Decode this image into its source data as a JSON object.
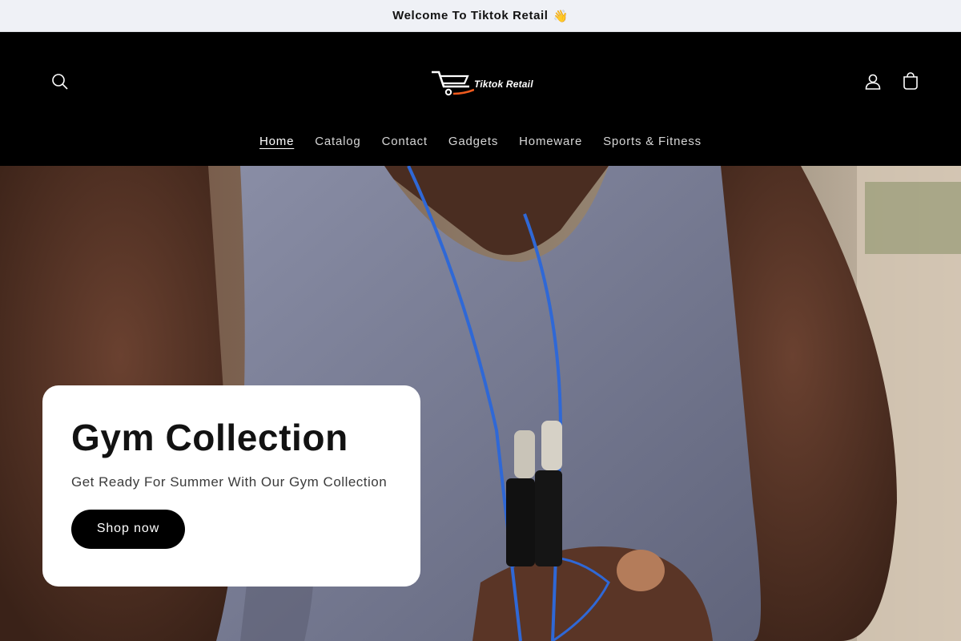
{
  "announcement": {
    "text": "Welcome To Tiktok Retail",
    "emoji": "👋"
  },
  "header": {
    "logo_text": "Tiktok Retail",
    "icons": [
      "search-icon",
      "account-icon",
      "cart-icon"
    ]
  },
  "nav": {
    "items": [
      {
        "label": "Home",
        "active": true
      },
      {
        "label": "Catalog"
      },
      {
        "label": "Contact"
      },
      {
        "label": "Gadgets"
      },
      {
        "label": "Homeware"
      },
      {
        "label": "Sports & Fitness"
      }
    ]
  },
  "hero": {
    "title": "Gym Collection",
    "subtitle": "Get Ready For Summer With Our Gym Collection",
    "cta_label": "Shop now"
  },
  "colors": {
    "header_bg": "#000000",
    "announcement_bg": "#eff1f6",
    "button_bg": "#000000",
    "card_bg": "#ffffff",
    "rope": "#2f68d6"
  }
}
